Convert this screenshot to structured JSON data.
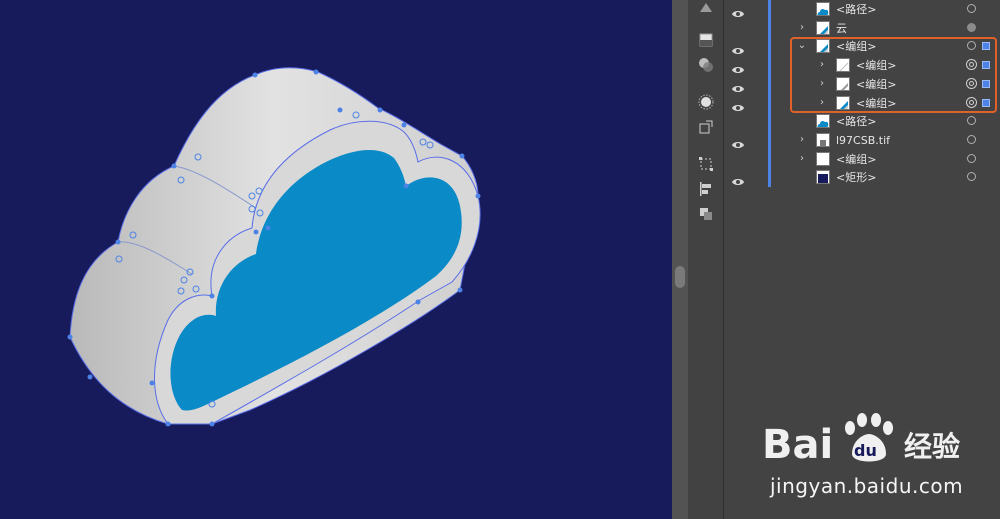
{
  "layers": [
    {
      "name": "<路径>",
      "visible": true,
      "expander": "",
      "indent": 0,
      "thumb": "cloud-blue",
      "target": "empty",
      "selected": false
    },
    {
      "name": "云",
      "visible": false,
      "expander": "›",
      "indent": 0,
      "thumb": "diag-blue",
      "target": "filled",
      "selected": false
    },
    {
      "name": "<编组>",
      "visible": true,
      "expander": "⌄",
      "indent": 0,
      "thumb": "diag-blue",
      "target": "empty",
      "selected": true
    },
    {
      "name": "<编组>",
      "visible": true,
      "expander": "›",
      "indent": 1,
      "thumb": "diag-white",
      "target": "double",
      "selected": true
    },
    {
      "name": "<编组>",
      "visible": true,
      "expander": "›",
      "indent": 1,
      "thumb": "diag-gray",
      "target": "double",
      "selected": true
    },
    {
      "name": "<编组>",
      "visible": true,
      "expander": "›",
      "indent": 1,
      "thumb": "diag-blue",
      "target": "double",
      "selected": true
    },
    {
      "name": "<路径>",
      "visible": false,
      "expander": "",
      "indent": 0,
      "thumb": "cloud-blue",
      "target": "empty",
      "selected": false
    },
    {
      "name": "l97CSB.tif",
      "visible": true,
      "expander": "›",
      "indent": 0,
      "thumb": "image",
      "target": "empty",
      "selected": false
    },
    {
      "name": "<编组>",
      "visible": false,
      "expander": "›",
      "indent": 0,
      "thumb": "blank",
      "target": "empty",
      "selected": false
    },
    {
      "name": "<矩形>",
      "visible": true,
      "expander": "",
      "indent": 0,
      "thumb": "navy",
      "target": "empty",
      "selected": false
    }
  ],
  "tools": [
    "gradient-icon",
    "swatch-icon",
    "transparency-icon",
    "appearance-icon",
    "export-icon",
    "transform-icon",
    "align-icon",
    "pathfinder-icon"
  ],
  "watermark": {
    "brand": "Bai du 经验",
    "url": "jingyan.baidu.com"
  },
  "colors": {
    "canvas": "#171b5c",
    "cloud_face": "#0a8ac6",
    "cloud_side": "#d6d6d6",
    "selection": "#4d83e6",
    "highlight": "#e0622a"
  }
}
